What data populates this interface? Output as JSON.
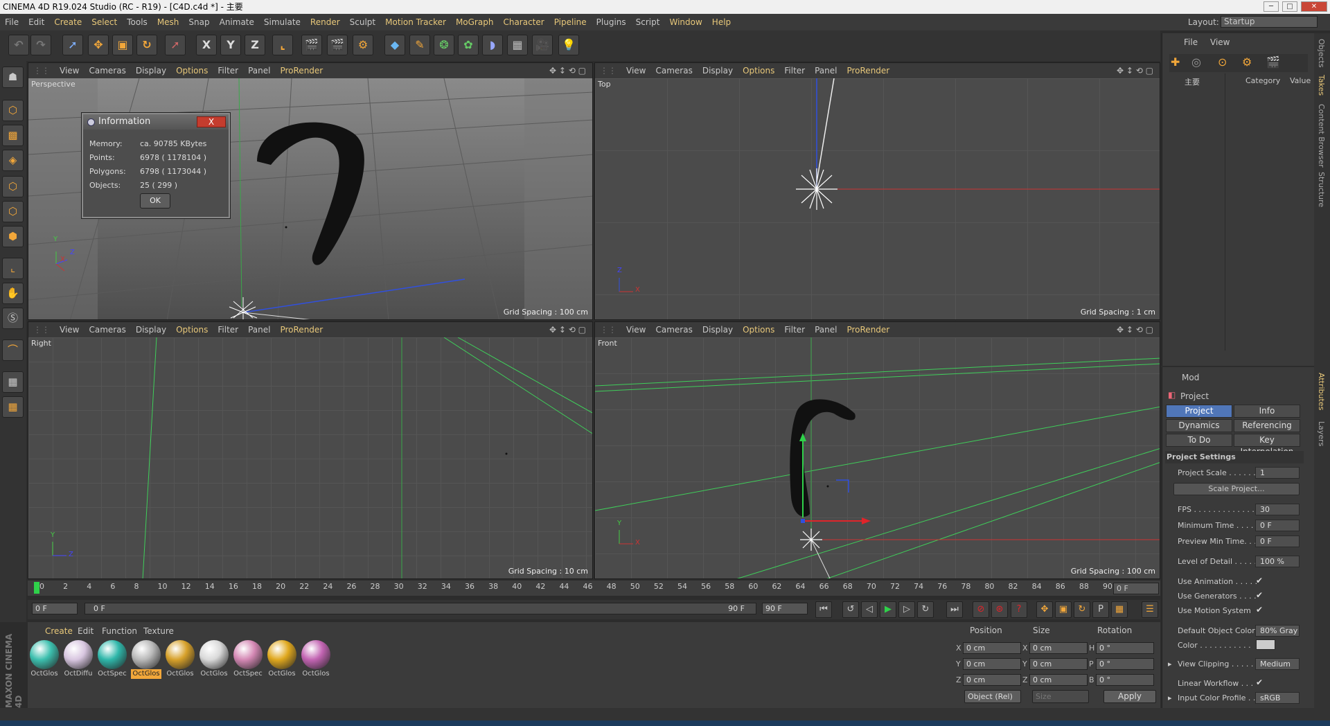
{
  "window": {
    "title": "CINEMA 4D R19.024 Studio (RC - R19) - [C4D.c4d *] - 主要"
  },
  "menu": [
    "File",
    "Edit",
    "Create",
    "Select",
    "Tools",
    "Mesh",
    "Snap",
    "Animate",
    "Simulate",
    "Render",
    "Sculpt",
    "Motion Tracker",
    "MoGraph",
    "Character",
    "Pipeline",
    "Plugins",
    "Script",
    "Window",
    "Help"
  ],
  "layout": {
    "label": "Layout:",
    "value": "Startup"
  },
  "toolbar": {
    "x": "X",
    "y": "Y",
    "z": "Z"
  },
  "viewport_menu": [
    "View",
    "Cameras",
    "Display",
    "Options",
    "Filter",
    "Panel",
    "ProRender"
  ],
  "viewports": {
    "perspective": {
      "name": "Perspective",
      "grid": "Grid Spacing : 100 cm"
    },
    "top": {
      "name": "Top",
      "grid": "Grid Spacing : 1 cm"
    },
    "right": {
      "name": "Right",
      "grid": "Grid Spacing : 10 cm"
    },
    "front": {
      "name": "Front",
      "grid": "Grid Spacing : 100 cm"
    }
  },
  "axis": {
    "x": "X",
    "y": "Y",
    "z": "Z"
  },
  "info_dialog": {
    "title": "Information",
    "close": "X",
    "ok": "OK",
    "rows": [
      {
        "label": "Memory:",
        "value": "ca. 90785 KBytes"
      },
      {
        "label": "Points:",
        "value": "6978 ( 1178104 )"
      },
      {
        "label": "Polygons:",
        "value": "6798 ( 1173044 )"
      },
      {
        "label": "Objects:",
        "value": "25 ( 299 )"
      }
    ]
  },
  "timeline": {
    "ticks": [
      "0",
      "2",
      "4",
      "6",
      "8",
      "10",
      "12",
      "14",
      "16",
      "18",
      "20",
      "22",
      "24",
      "26",
      "28",
      "30",
      "32",
      "34",
      "36",
      "38",
      "40",
      "42",
      "44",
      "46",
      "48",
      "50",
      "52",
      "54",
      "56",
      "58",
      "60",
      "62",
      "64",
      "66",
      "68",
      "70",
      "72",
      "74",
      "76",
      "78",
      "80",
      "82",
      "84",
      "86",
      "88",
      "90"
    ],
    "current_frame": "0 F",
    "start": "0 F",
    "range_start": "0 F",
    "range_end": "90 F",
    "end": "90 F"
  },
  "materials": {
    "tabs": [
      "Create",
      "Edit",
      "Function",
      "Texture"
    ],
    "items": [
      {
        "label": "OctGlos",
        "color": "#3cbfae"
      },
      {
        "label": "OctDiffu",
        "color": "#d8c6e0"
      },
      {
        "label": "OctSpec",
        "color": "#2fb7aa"
      },
      {
        "label": "OctGlos",
        "color": "#b9b9b9"
      },
      {
        "label": "OctGlos",
        "color": "#d7a12a"
      },
      {
        "label": "OctGlos",
        "color": "#d9d9d9"
      },
      {
        "label": "OctSpec",
        "color": "#d488b4"
      },
      {
        "label": "OctGlos",
        "color": "#e0a81e"
      },
      {
        "label": "OctGlos",
        "color": "#c264b2"
      }
    ],
    "selected_index": 3
  },
  "coordinates": {
    "headers": [
      "Position",
      "Size",
      "Rotation"
    ],
    "position": [
      {
        "axis": "X",
        "value": "0 cm"
      },
      {
        "axis": "Y",
        "value": "0 cm"
      },
      {
        "axis": "Z",
        "value": "0 cm"
      }
    ],
    "size": [
      {
        "axis": "X",
        "value": "0 cm"
      },
      {
        "axis": "Y",
        "value": "0 cm"
      },
      {
        "axis": "Z",
        "value": "0 cm"
      }
    ],
    "rotation": [
      {
        "axis": "H",
        "value": "0 °"
      },
      {
        "axis": "P",
        "value": "0 °"
      },
      {
        "axis": "B",
        "value": "0 °"
      }
    ],
    "mode": "Object (Rel)",
    "size_mode": "Size",
    "apply": "Apply"
  },
  "objects": {
    "menu": [
      "File",
      "View"
    ],
    "root": "主要",
    "cols": [
      "Category",
      "Value"
    ]
  },
  "attributes": {
    "mode": "Mod",
    "object": "Project",
    "tabs": [
      "Project Settings",
      "Info",
      "Dynamics",
      "Referencing",
      "To Do",
      "Key Interpolation"
    ],
    "section": "Project Settings",
    "project_scale": {
      "label": "Project Scale . . . . . .",
      "value": "1"
    },
    "scale_button": "Scale Project...",
    "fps": {
      "label": "FPS . . . . . . . . . . . . . .",
      "value": "30"
    },
    "min_time": {
      "label": "Minimum Time . . . .",
      "value": "0 F"
    },
    "preview_min": {
      "label": "Preview Min Time. . .",
      "value": "0 F"
    },
    "lod": {
      "label": "Level of Detail . . . . .",
      "value": "100 %"
    },
    "use_animation": "Use Animation . . . . .",
    "use_generators": "Use Generators . . . .",
    "use_motion": "Use Motion System",
    "def_color": {
      "label": "Default Object Color",
      "value": "80% Gray"
    },
    "color": "Color . . . . . . . . . . .",
    "clipping": {
      "label": "View Clipping . . . . .",
      "value": "Medium"
    },
    "linear": "Linear Workflow . . .",
    "profile": {
      "label": "Input Color Profile . .",
      "value": "sRGB"
    }
  },
  "side_tabs": [
    "Objects",
    "Takes",
    "Content Browser",
    "Structure",
    "Attributes",
    "Layers"
  ],
  "brand": "MAXON CINEMA 4D"
}
